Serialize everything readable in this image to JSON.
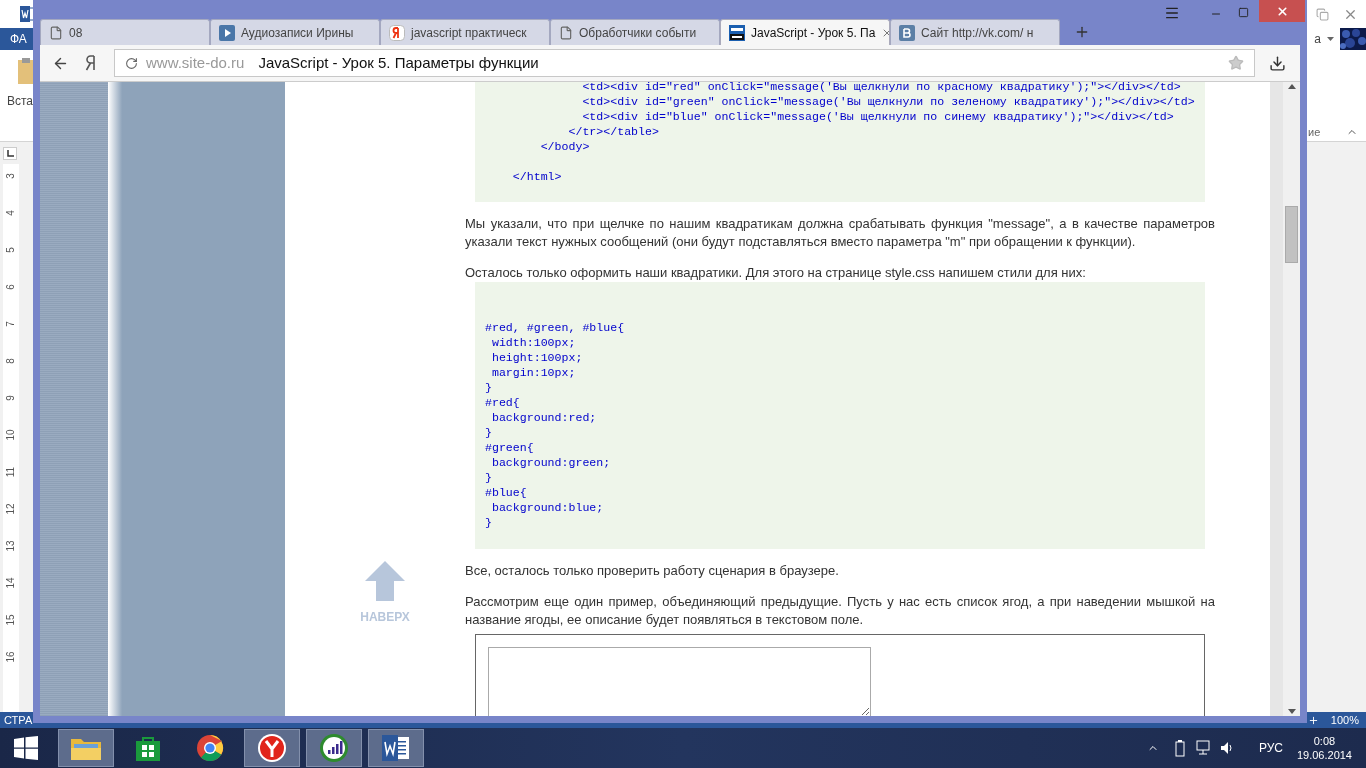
{
  "word": {
    "menu_tab": "ФА",
    "ribbon_button": "Вста",
    "account": "а",
    "ribbon_group": "ие",
    "ruler": [
      "3",
      "4",
      "5",
      "6",
      "7",
      "8",
      "9",
      "10",
      "11",
      "12",
      "13",
      "14",
      "15",
      "16"
    ],
    "status": "СТРА",
    "zoom": "100%"
  },
  "browser": {
    "tabs": [
      {
        "label": "08",
        "kind": "page",
        "selected": false
      },
      {
        "label": "Аудиозаписи Ирины",
        "kind": "play",
        "selected": false
      },
      {
        "label": "javascript практическ",
        "kind": "yandex",
        "selected": false
      },
      {
        "label": "Обработчики событи",
        "kind": "page",
        "selected": false
      },
      {
        "label": "JavaScript - Урок 5. Па",
        "kind": "site",
        "selected": true
      },
      {
        "label": "Сайт http://vk.com/ н",
        "kind": "vk",
        "selected": false
      }
    ],
    "address": {
      "host": "www.site-do.ru",
      "title": "JavaScript - Урок 5. Параметры функции"
    },
    "to_top": "НАВЕРХ",
    "content": [
      {
        "kind": "code",
        "groups": [
          [
            "              <td><div id=\"red\" onClick=\"message('Вы щелкнули по красному квадратику');\"></div></td>",
            "              <td><div id=\"green\" onClick=\"message('Вы щелкнули по зеленому квадратику');\"></div></td>",
            "              <td><div id=\"blue\" onClick=\"message('Вы щелкнули по синему квадратику');\"></div></td>",
            "            </tr></table>",
            "        </body>"
          ],
          [
            "    </html>"
          ]
        ]
      },
      {
        "kind": "paragraph",
        "text": "Мы указали, что при щелчке по нашим квадратикам должна срабатывать функция \"message\", а в качестве параметров указали текст нужных сообщений (они будут подставляться вместо параметра \"m\" при обращении к функции)."
      },
      {
        "kind": "paragraph",
        "text": "Осталось только оформить наши квадратики. Для этого на странице style.css напишем стили для них:"
      },
      {
        "kind": "code",
        "groups": [
          [
            "#red, #green, #blue{",
            " width:100px;",
            " height:100px;",
            " margin:10px;",
            "}",
            "#red{",
            " background:red;",
            "}",
            "#green{",
            " background:green;",
            "}",
            "#blue{",
            " background:blue;",
            "}"
          ]
        ]
      },
      {
        "kind": "paragraph",
        "text": "Все, осталось только проверить работу сценария в браузере."
      },
      {
        "kind": "paragraph",
        "text": "Рассмотрим еще один пример, объединяющий предыдущие. Пусть у нас есть список ягод, а при наведении мышкой на название ягоды, ее описание будет появляться в текстовом поле."
      },
      {
        "kind": "textarea"
      }
    ]
  },
  "taskbar": {
    "apps": [
      {
        "kind": "explorer",
        "running": true
      },
      {
        "kind": "store",
        "running": false
      },
      {
        "kind": "chrome",
        "running": false
      },
      {
        "kind": "yandex",
        "running": true
      },
      {
        "kind": "meter",
        "running": true
      },
      {
        "kind": "word",
        "running": true
      }
    ],
    "language": "РУС",
    "time": "0:08",
    "date": "19.06.2014"
  }
}
